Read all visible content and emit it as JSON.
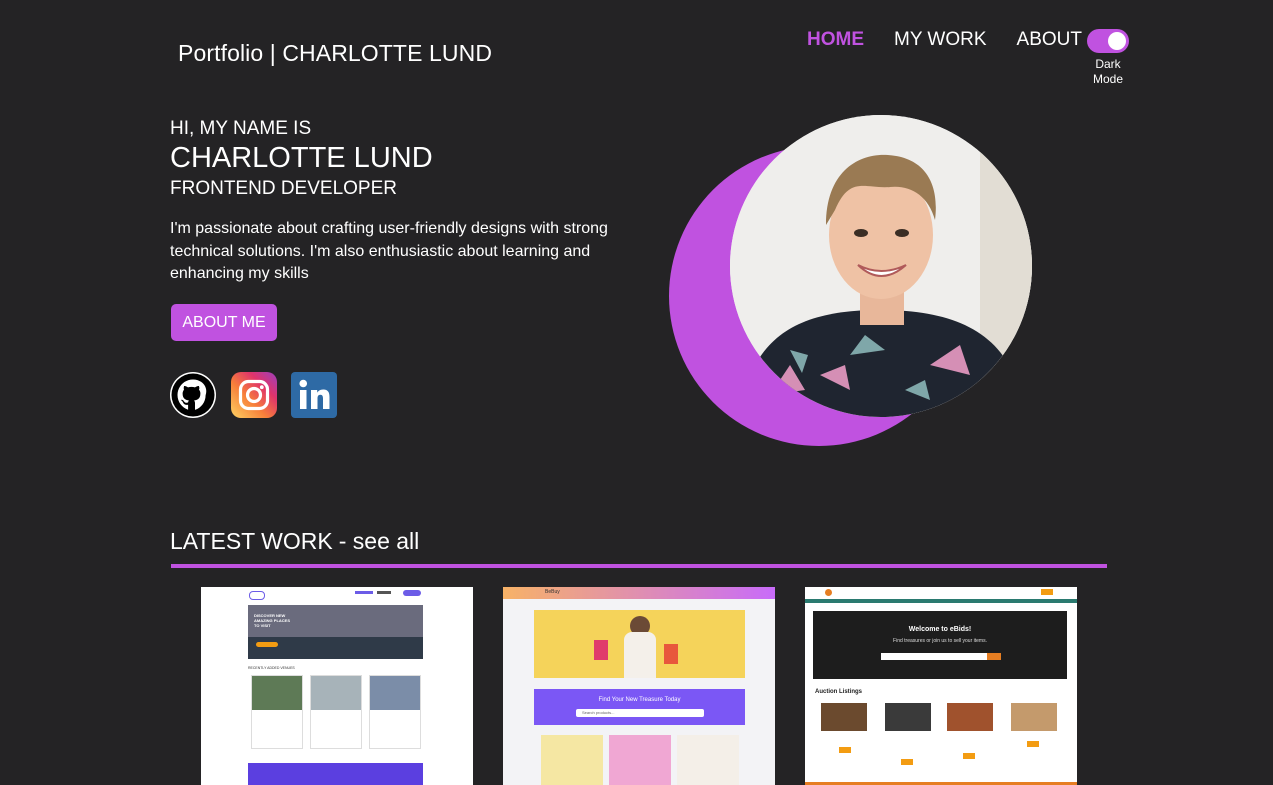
{
  "header": {
    "brand": "Portfolio | CHARLOTTE LUND",
    "nav": [
      {
        "label": "HOME",
        "active": true
      },
      {
        "label": "MY WORK",
        "active": false
      },
      {
        "label": "ABOUT",
        "active": false
      }
    ],
    "dark_mode_label": "Dark Mode",
    "dark_mode_on": true
  },
  "hero": {
    "intro": "HI, MY NAME IS",
    "name": "CHARLOTTE LUND",
    "role": "FRONTEND DEVELOPER",
    "description": "I'm passionate about crafting user-friendly designs with strong technical solutions. I'm also enthusiastic about learning and enhancing my skills",
    "cta_label": "ABOUT ME",
    "social": [
      {
        "name": "github",
        "icon": "github-icon"
      },
      {
        "name": "instagram",
        "icon": "instagram-icon"
      },
      {
        "name": "linkedin",
        "icon": "linkedin-icon"
      }
    ]
  },
  "latest_work": {
    "title": "LATEST WORK",
    "see_all": "- see all",
    "projects": [
      {
        "hero_text": "DISCOVER NEW AMAZING PLACES TO VISIT",
        "section": "RECENTLY ADDED VENUES"
      },
      {
        "brand": "BeBuy",
        "banner": "Find Your New Treasure Today",
        "search_placeholder": "Search products..."
      },
      {
        "headline": "Welcome to eBids!",
        "subline": "Find treasures or join us to sell your items.",
        "section": "Auction Listings"
      }
    ]
  },
  "colors": {
    "background": "#242325",
    "accent": "#c052e0",
    "text": "#ffffff"
  }
}
